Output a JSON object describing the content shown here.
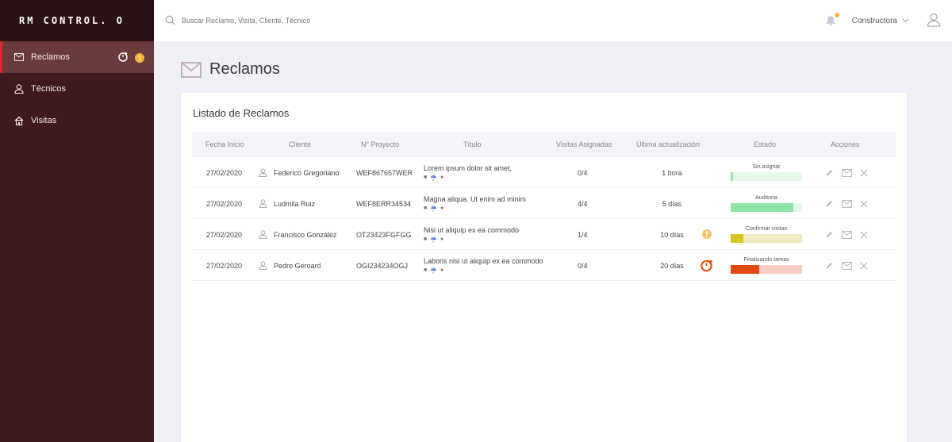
{
  "brand": "RM CONTROL. O",
  "sidebar": {
    "items": [
      {
        "label": "Reclamos",
        "icon": "mail-icon",
        "active": true
      },
      {
        "label": "Técnicos",
        "icon": "user-icon",
        "active": false
      },
      {
        "label": "Visitas",
        "icon": "home-icon",
        "active": false
      }
    ],
    "warn_badge": "!"
  },
  "search": {
    "placeholder": "Buscar Reclamo, Visita, Cliente, Técnico"
  },
  "header": {
    "org": "Constructora"
  },
  "page": {
    "title": "Reclamos"
  },
  "list": {
    "title": "Listado de Reclamos",
    "columns": [
      "Fecha Inicio",
      "Cliente",
      "N° Proyecto",
      "Título",
      "Visitas Asignadas",
      "Última actualización",
      "Estado",
      "Acciones"
    ],
    "rows": [
      {
        "fecha": "27/02/2020",
        "cliente": "Federico Gregoriano",
        "proyecto": "WEF867657WER",
        "titulo": "Lorem ipsum dolor sit amet,",
        "visitas": "0/4",
        "actualizacion": "1 hora",
        "alert": "",
        "estado": "Sin asignar",
        "progress": 0.03,
        "bar_color": "#8ee6a4",
        "track_color": "#e6f9ea"
      },
      {
        "fecha": "27/02/2020",
        "cliente": "Ludmila Ruiz",
        "proyecto": "WEF8ERR34534",
        "titulo": "Magna aliqua. Ut enim ad minim",
        "visitas": "4/4",
        "actualizacion": "5 días",
        "alert": "",
        "estado": "Auditoria",
        "progress": 0.88,
        "bar_color": "#8ee6a4",
        "track_color": "#e6f9ea"
      },
      {
        "fecha": "27/02/2020",
        "cliente": "Francisco González",
        "proyecto": "OT23423FGFGG",
        "titulo": "Nisi ut aliquip ex ea commodo",
        "visitas": "1/4",
        "actualizacion": "10 días",
        "alert": "warning",
        "estado": "Confirmar visitas",
        "progress": 0.18,
        "bar_color": "#d8c51e",
        "track_color": "#efeac2"
      },
      {
        "fecha": "27/02/2020",
        "cliente": "Pedro Geroard",
        "proyecto": "OGI234234OGJ",
        "titulo": "Laboris nisi ut aliquip ex ea commodo",
        "visitas": "0/4",
        "actualizacion": "20 días",
        "alert": "timer",
        "estado": "Finalizando tareas",
        "progress": 0.4,
        "bar_color": "#e24a12",
        "track_color": "#f7cfc2"
      }
    ]
  }
}
